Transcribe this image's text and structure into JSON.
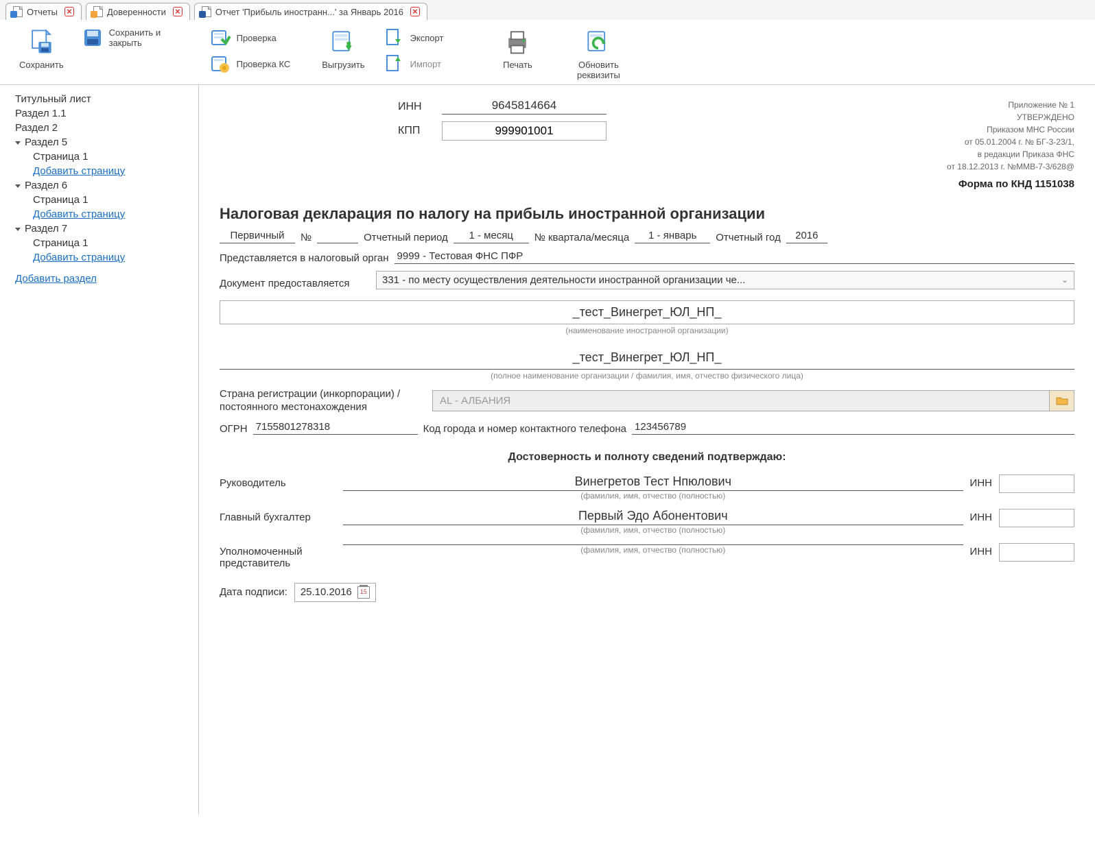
{
  "tabs": [
    {
      "label": "Отчеты",
      "active": false,
      "iconMark": "blue"
    },
    {
      "label": "Доверенности",
      "active": false,
      "iconMark": "orange"
    },
    {
      "label": "Отчет 'Прибыль иностранн...' за Январь 2016",
      "active": true,
      "iconMark": "dark"
    }
  ],
  "toolbar": {
    "save": "Сохранить",
    "save_close": "Сохранить и закрыть",
    "check": "Проверка",
    "check_ks": "Проверка КС",
    "export_btn": "Выгрузить",
    "export": "Экспорт",
    "import": "Импорт",
    "print": "Печать",
    "refresh": "Обновить реквизиты"
  },
  "sidebar": {
    "title_page": "Титульный лист",
    "s11": "Раздел 1.1",
    "s2": "Раздел 2",
    "s5": "Раздел 5",
    "s6": "Раздел 6",
    "s7": "Раздел 7",
    "page1": "Страница 1",
    "add_page": "Добавить страницу",
    "add_section": "Добавить раздел"
  },
  "approval": {
    "l1": "Приложение № 1",
    "l2": "УТВЕРЖДЕНО",
    "l3": "Приказом МНС России",
    "l4": "от 05.01.2004 г. № БГ-3-23/1,",
    "l5": "в редакции Приказа ФНС",
    "l6": "от 18.12.2013 г. №ММВ-7-3/628@",
    "form_code": "Форма по КНД 1151038"
  },
  "ids": {
    "inn_label": "ИНН",
    "inn": "9645814664",
    "kpp_label": "КПП",
    "kpp": "999901001"
  },
  "title": "Налоговая декларация по налогу на прибыль иностранной организации",
  "periodic": {
    "primary": "Первичный",
    "num_label": "№",
    "num": "",
    "period_label": "Отчетный период",
    "period": "1 - месяц",
    "quarter_label": "№ квартала/месяца",
    "quarter": "1 - январь",
    "year_label": "Отчетный год",
    "year": "2016"
  },
  "tax_auth": {
    "label": "Представляется в налоговый орган",
    "value": "9999 - Тестовая ФНС ПФР"
  },
  "doc_place": {
    "label": "Документ предоставляется",
    "value": "331 - по месту осуществления деятельности иностранной организации че..."
  },
  "org_name_short": "_тест_Винегрет_ЮЛ_НП_",
  "org_name_short_hint": "(наименование иностранной организации)",
  "org_name_full": "_тест_Винегрет_ЮЛ_НП_",
  "org_name_full_hint": "(полное наименование организации / фамилия, имя, отчество физического лица)",
  "country": {
    "label": "Страна регистрации (инкорпорации) / постоянного местонахождения",
    "value": "AL - АЛБАНИЯ"
  },
  "ogrn": {
    "label": "ОГРН",
    "value": "7155801278318"
  },
  "phone": {
    "label": "Код города и номер контактного телефона",
    "value": "123456789"
  },
  "sig": {
    "title": "Достоверность и полноту сведений подтверждаю:",
    "hint": "(фамилия, имя, отчество (полностью)",
    "inn": "ИНН",
    "head_role": "Руководитель",
    "head_name": "Винегретов Тест Нпюлович",
    "acct_role": "Главный бухгалтер",
    "acct_name": "Первый Эдо Абонентович",
    "rep_role": "Уполномоченный представитель",
    "rep_name": ""
  },
  "sign_date": {
    "label": "Дата подписи:",
    "value": "25.10.2016",
    "day": "15"
  }
}
